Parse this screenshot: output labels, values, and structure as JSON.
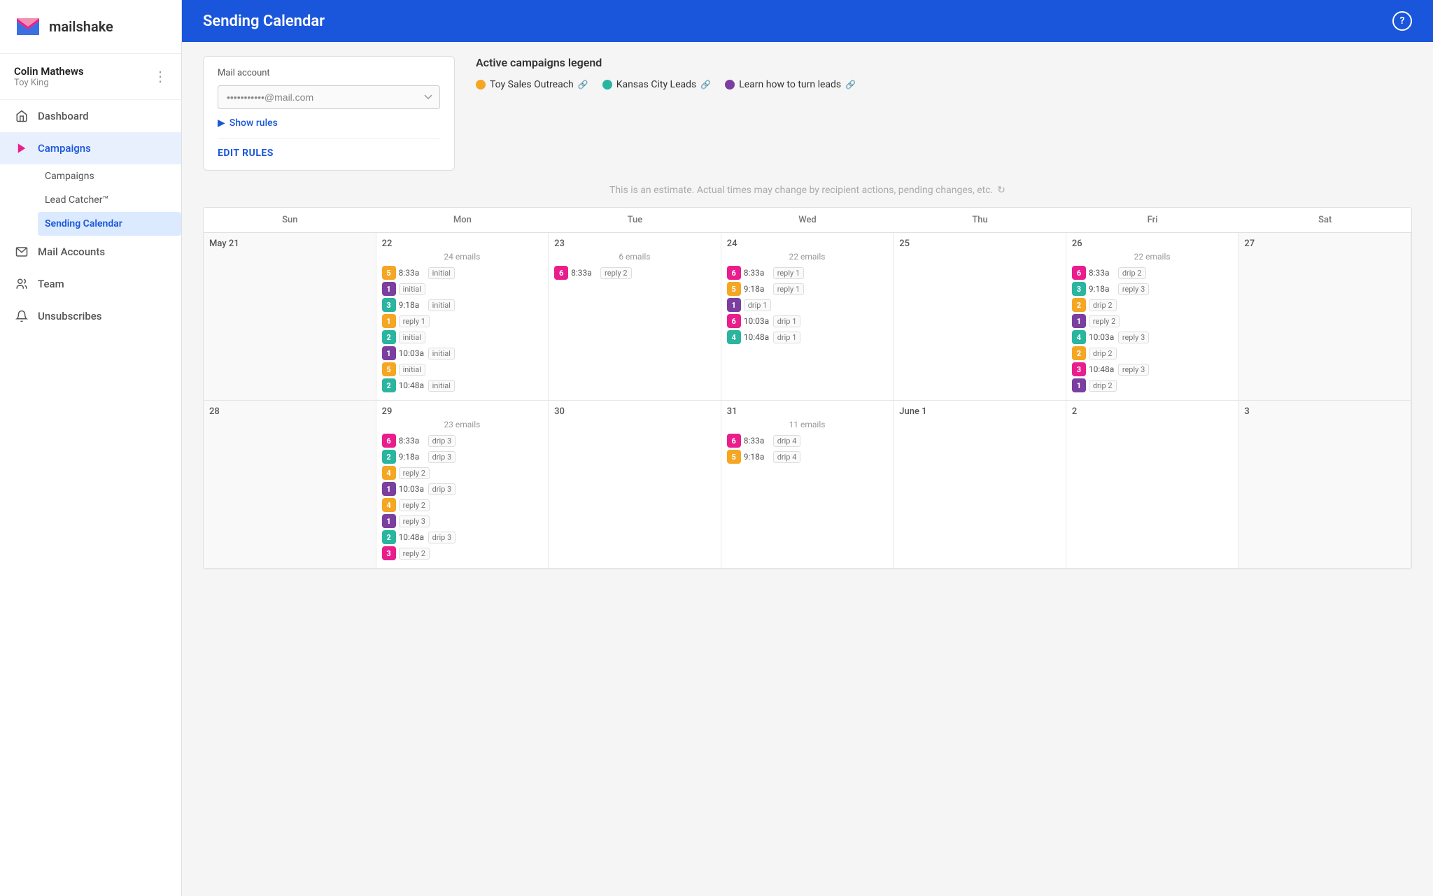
{
  "app": {
    "name": "mailshake"
  },
  "user": {
    "name": "Colin Mathews",
    "org": "Toy King"
  },
  "sidebar": {
    "items": [
      {
        "id": "dashboard",
        "label": "Dashboard",
        "icon": "home"
      },
      {
        "id": "campaigns",
        "label": "Campaigns",
        "icon": "arrow",
        "active": true
      },
      {
        "id": "mail-accounts",
        "label": "Mail Accounts",
        "icon": "mail"
      },
      {
        "id": "team",
        "label": "Team",
        "icon": "people"
      },
      {
        "id": "unsubscribes",
        "label": "Unsubscribes",
        "icon": "bell"
      }
    ],
    "sub_items": [
      {
        "id": "campaigns-sub",
        "label": "Campaigns"
      },
      {
        "id": "lead-catcher",
        "label": "Lead Catcher™"
      },
      {
        "id": "sending-calendar",
        "label": "Sending Calendar",
        "active": true
      }
    ]
  },
  "header": {
    "title": "Sending Calendar",
    "help_label": "?"
  },
  "mail_account": {
    "label": "Mail account",
    "value": "•••••••••••@mail.com",
    "placeholder": "•••••••••••@mail.com"
  },
  "show_rules": {
    "label": "Show rules"
  },
  "edit_rules": {
    "label": "EDIT RULES"
  },
  "legend": {
    "title": "Active campaigns legend",
    "items": [
      {
        "id": "toy-sales",
        "label": "Toy Sales Outreach",
        "color": "#f5a623"
      },
      {
        "id": "kansas-city",
        "label": "Kansas City Leads",
        "color": "#2ab5a0"
      },
      {
        "id": "learn-how",
        "label": "Learn how to turn leads",
        "color": "#7b3fa0"
      }
    ]
  },
  "estimate_notice": {
    "text": "This is an estimate. Actual times may change by recipient actions, pending changes, etc."
  },
  "calendar": {
    "day_headers": [
      "Sun",
      "Mon",
      "Tue",
      "Wed",
      "Thu",
      "Fri",
      "Sat"
    ],
    "weeks": [
      {
        "days": [
          {
            "date": "May 21",
            "weekend": true,
            "other": false,
            "email_count": null,
            "entries": []
          },
          {
            "date": "22",
            "email_count": "24 emails",
            "entries": [
              {
                "badge": "5",
                "badge_class": "badge-orange",
                "time": "8:33a",
                "tag": "initial"
              },
              {
                "badge": "1",
                "badge_class": "badge-purple",
                "time": "",
                "tag": "initial"
              },
              {
                "badge": "3",
                "badge_class": "badge-teal",
                "time": "9:18a",
                "tag": "initial"
              },
              {
                "badge": "1",
                "badge_class": "badge-orange",
                "time": "",
                "tag": "reply 1"
              },
              {
                "badge": "2",
                "badge_class": "badge-teal",
                "time": "",
                "tag": "initial"
              },
              {
                "badge": "1",
                "badge_class": "badge-purple",
                "time": "10:03a",
                "tag": "initial"
              },
              {
                "badge": "5",
                "badge_class": "badge-orange",
                "time": "",
                "tag": "initial"
              },
              {
                "badge": "2",
                "badge_class": "badge-teal",
                "time": "10:48a",
                "tag": "initial"
              }
            ]
          },
          {
            "date": "23",
            "email_count": "6 emails",
            "entries": [
              {
                "badge": "6",
                "badge_class": "badge-pink",
                "time": "8:33a",
                "tag": "reply 2"
              }
            ]
          },
          {
            "date": "24",
            "email_count": "22 emails",
            "entries": [
              {
                "badge": "6",
                "badge_class": "badge-pink",
                "time": "8:33a",
                "tag": "reply 1"
              },
              {
                "badge": "5",
                "badge_class": "badge-orange",
                "time": "9:18a",
                "tag": "reply 1"
              },
              {
                "badge": "1",
                "badge_class": "badge-purple",
                "time": "",
                "tag": "drip 1"
              },
              {
                "badge": "6",
                "badge_class": "badge-pink",
                "time": "10:03a",
                "tag": "drip 1"
              },
              {
                "badge": "4",
                "badge_class": "badge-teal",
                "time": "10:48a",
                "tag": "drip 1"
              }
            ]
          },
          {
            "date": "25",
            "email_count": null,
            "entries": []
          },
          {
            "date": "26",
            "email_count": "22 emails",
            "entries": [
              {
                "badge": "6",
                "badge_class": "badge-pink",
                "time": "8:33a",
                "tag": "drip 2"
              },
              {
                "badge": "3",
                "badge_class": "badge-teal",
                "time": "9:18a",
                "tag": "reply 3"
              },
              {
                "badge": "2",
                "badge_class": "badge-orange",
                "time": "",
                "tag": "drip 2"
              },
              {
                "badge": "1",
                "badge_class": "badge-purple",
                "time": "",
                "tag": "reply 2"
              },
              {
                "badge": "4",
                "badge_class": "badge-teal",
                "time": "10:03a",
                "tag": "reply 3"
              },
              {
                "badge": "2",
                "badge_class": "badge-orange",
                "time": "",
                "tag": "drip 2"
              },
              {
                "badge": "3",
                "badge_class": "badge-pink",
                "time": "10:48a",
                "tag": "reply 3"
              },
              {
                "badge": "1",
                "badge_class": "badge-purple",
                "time": "",
                "tag": "drip 2"
              }
            ]
          },
          {
            "date": "27",
            "weekend": true,
            "email_count": null,
            "entries": []
          }
        ]
      },
      {
        "days": [
          {
            "date": "28",
            "weekend": true,
            "other": false,
            "email_count": null,
            "entries": []
          },
          {
            "date": "29",
            "email_count": "23 emails",
            "entries": [
              {
                "badge": "6",
                "badge_class": "badge-pink",
                "time": "8:33a",
                "tag": "drip 3"
              },
              {
                "badge": "2",
                "badge_class": "badge-teal",
                "time": "9:18a",
                "tag": "drip 3"
              },
              {
                "badge": "4",
                "badge_class": "badge-orange",
                "time": "",
                "tag": "reply 2"
              },
              {
                "badge": "1",
                "badge_class": "badge-purple",
                "time": "10:03a",
                "tag": "drip 3"
              },
              {
                "badge": "4",
                "badge_class": "badge-orange",
                "time": "",
                "tag": "reply 2"
              },
              {
                "badge": "1",
                "badge_class": "badge-purple",
                "time": "",
                "tag": "reply 3"
              },
              {
                "badge": "2",
                "badge_class": "badge-teal",
                "time": "10:48a",
                "tag": "drip 3"
              },
              {
                "badge": "3",
                "badge_class": "badge-pink",
                "time": "",
                "tag": "reply 2"
              }
            ]
          },
          {
            "date": "30",
            "email_count": null,
            "entries": []
          },
          {
            "date": "31",
            "email_count": "11 emails",
            "entries": [
              {
                "badge": "6",
                "badge_class": "badge-pink",
                "time": "8:33a",
                "tag": "drip 4"
              },
              {
                "badge": "5",
                "badge_class": "badge-orange",
                "time": "9:18a",
                "tag": "drip 4"
              }
            ]
          },
          {
            "date": "June 1",
            "email_count": null,
            "entries": []
          },
          {
            "date": "2",
            "email_count": null,
            "entries": []
          },
          {
            "date": "3",
            "weekend": true,
            "email_count": null,
            "entries": []
          }
        ]
      }
    ]
  }
}
